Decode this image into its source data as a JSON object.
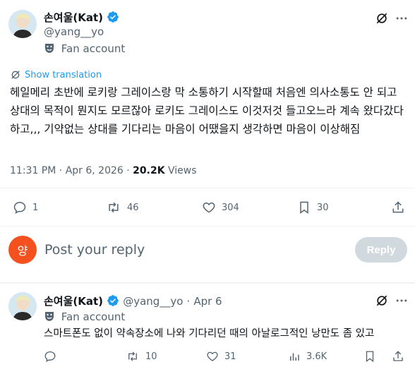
{
  "main_tweet": {
    "author_name": "손여울(Kat)",
    "handle": "@yang__yo",
    "fan_label": "Fan account",
    "show_translation": "Show translation",
    "text": "헤일메리 초반에 로키랑 그레이스랑 막 소통하기 시작할때 처음엔 의사소통도 안 되고 상대의 목적이 뭔지도 모르잖아 로키도 그레이스도 이것저것 들고오느라 계속 왔다갔다하고,,, 기약없는 상대를 기다리는 마음이 어땠을지 생각하면 마음이 이상해짐",
    "time": "11:31 PM",
    "date": "Apr 6, 2026",
    "views_count": "20.2K",
    "views_label": "Views",
    "replies": "1",
    "reposts": "46",
    "likes": "304",
    "bookmarks": "30"
  },
  "reply_box": {
    "avatar_letter": "양",
    "placeholder": "Post your reply",
    "button_label": "Reply"
  },
  "reply_tweet": {
    "author_name": "손여울(Kat)",
    "handle": "@yang__yo",
    "separator": "·",
    "date": "Apr 6",
    "fan_label": "Fan account",
    "text": "스마트폰도 없이 약속장소에 나와 기다리던 때의 아날로그적인 낭만도 좀 있고",
    "replies": "",
    "reposts": "10",
    "likes": "31",
    "views": "3.6K"
  },
  "colors": {
    "accent": "#1d9bf0",
    "muted": "#536471",
    "reply_button_disabled": "#8ecdf7",
    "avatar_bg": "#f4511e"
  }
}
